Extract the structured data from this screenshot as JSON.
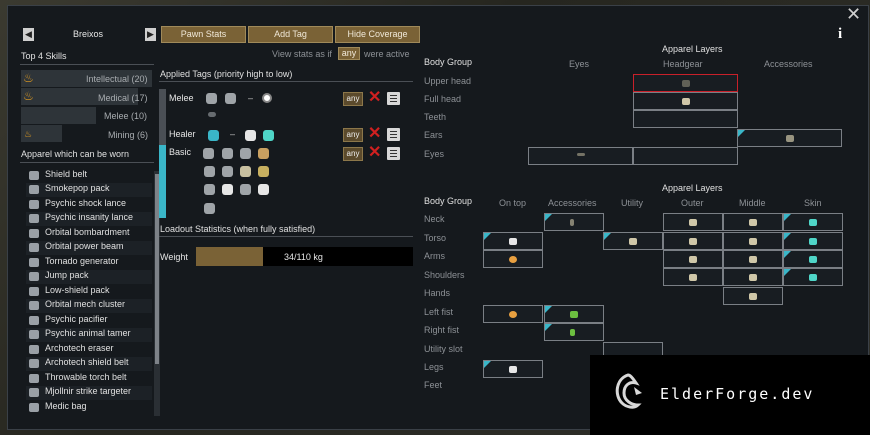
{
  "pawn": {
    "name": "Breixos"
  },
  "toolbar": {
    "pawn_stats": "Pawn Stats",
    "add_tag": "Add Tag",
    "hide_coverage": "Hide Coverage"
  },
  "view_stats": {
    "prefix": "View stats as if",
    "value": "any",
    "suffix": "were active"
  },
  "skills": {
    "heading": "Top 4 Skills",
    "items": [
      "Intellectual (20)",
      "Medical (17)",
      "Melee (10)",
      "Mining (6)"
    ],
    "values": [
      20,
      17,
      10,
      6
    ]
  },
  "apparel_list": {
    "heading": "Apparel which can be worn",
    "items": [
      "Shield belt",
      "Smokepop pack",
      "Psychic shock lance",
      "Psychic insanity lance",
      "Orbital bombardment",
      "Orbital power beam",
      "Tornado generator",
      "Jump pack",
      "Low-shield pack",
      "Orbital mech cluster",
      "Psychic pacifier",
      "Psychic animal tamer",
      "Archotech eraser",
      "Archotech shield belt",
      "Throwable torch belt",
      "Mjollnir strike targeter",
      "Medic bag"
    ]
  },
  "tags": {
    "heading": "Applied Tags (priority high to low)",
    "rows": [
      {
        "name": "Melee",
        "dash": "–",
        "mode": "any"
      },
      {
        "name": "Healer",
        "dash": "–",
        "mode": "any"
      },
      {
        "name": "Basic",
        "mode": "any"
      }
    ]
  },
  "loadout": {
    "heading": "Loadout Statistics (when fully satisfied)",
    "weight_label": "Weight",
    "weight_text": "34/110 kg",
    "weight_current": 34,
    "weight_max": 110
  },
  "grid1": {
    "title": "Apparel Layers",
    "body_group_header": "Body Group",
    "columns": [
      "Eyes",
      "Headgear",
      "Accessories"
    ],
    "rows": [
      "Upper head",
      "Full head",
      "Teeth",
      "Ears",
      "Eyes"
    ]
  },
  "grid2": {
    "title": "Apparel Layers",
    "body_group_header": "Body Group",
    "columns": [
      "On top",
      "Accessories",
      "Utility",
      "Outer",
      "Middle",
      "Skin"
    ],
    "rows": [
      "Neck",
      "Torso",
      "Arms",
      "Shoulders",
      "Hands",
      "Left fist",
      "Right fist",
      "Utility slot",
      "Legs",
      "Feet"
    ]
  },
  "colors": {
    "button_bg": "#7a6236",
    "accent_cyan": "#3ab6c8",
    "highlight_red": "#c8202a",
    "window_bg": "#15191d"
  },
  "watermark": {
    "text": "ElderForge.dev"
  }
}
